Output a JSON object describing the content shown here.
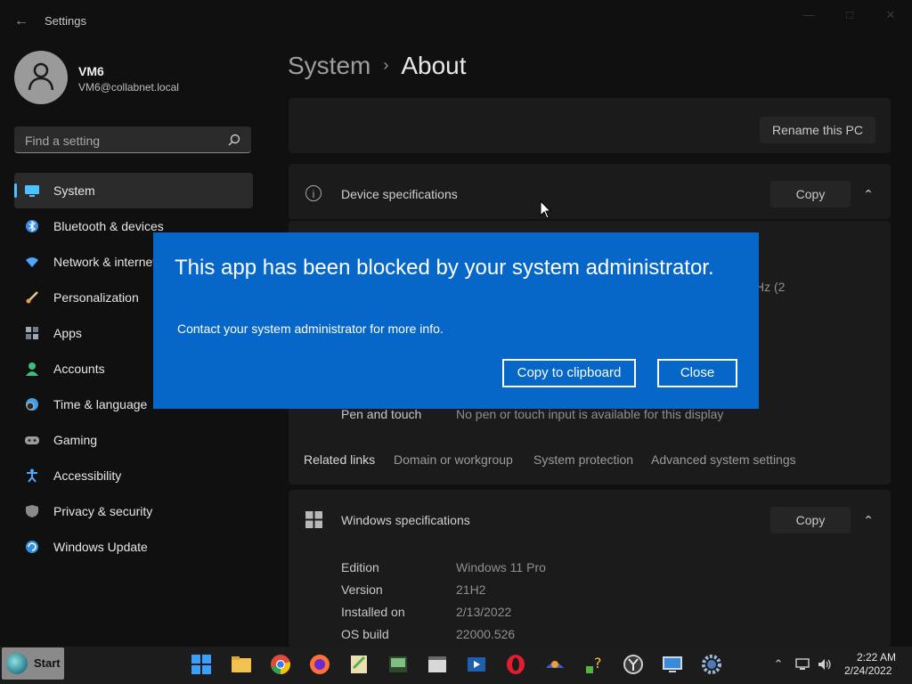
{
  "window": {
    "app_title": "Settings",
    "back_icon": "back-arrow-icon",
    "controls": {
      "minimize": "—",
      "maximize": "□",
      "close": "✕"
    }
  },
  "user": {
    "name": "VM6",
    "email": "VM6@collabnet.local",
    "avatar_icon": "person-icon"
  },
  "search": {
    "placeholder": "Find a setting"
  },
  "sidebar": {
    "items": [
      {
        "label": "System",
        "icon": "monitor-icon",
        "color": "#4cc2ff",
        "active": true
      },
      {
        "label": "Bluetooth & devices",
        "icon": "bluetooth-icon",
        "color": "#3b8ee8"
      },
      {
        "label": "Network & internet",
        "icon": "wifi-icon",
        "color": "#4ca8ff"
      },
      {
        "label": "Personalization",
        "icon": "brush-icon",
        "color": "#e8a050"
      },
      {
        "label": "Apps",
        "icon": "apps-icon",
        "color": "#9fa9b8"
      },
      {
        "label": "Accounts",
        "icon": "account-icon",
        "color": "#3fbf7f"
      },
      {
        "label": "Time & language",
        "icon": "clock-globe-icon",
        "color": "#3f9fe8"
      },
      {
        "label": "Gaming",
        "icon": "gamepad-icon",
        "color": "#9c9c9c"
      },
      {
        "label": "Accessibility",
        "icon": "accessibility-icon",
        "color": "#4ca8ff"
      },
      {
        "label": "Privacy & security",
        "icon": "shield-icon",
        "color": "#8a8a8a"
      },
      {
        "label": "Windows Update",
        "icon": "update-icon",
        "color": "#2f8fe0"
      }
    ]
  },
  "breadcrumb": {
    "parent": "System",
    "separator": "›",
    "current": "About"
  },
  "rename": {
    "label": "Rename this PC"
  },
  "device_specs": {
    "title": "Device specifications",
    "copy_label": "Copy",
    "partial_value": "Hz  (2",
    "rows": [
      {
        "label": "Pen and touch",
        "value": "No pen or touch input is available for this display"
      }
    ]
  },
  "related_links": {
    "title": "Related links",
    "links": [
      "Domain or workgroup",
      "System protection",
      "Advanced system settings"
    ]
  },
  "windows_specs": {
    "title": "Windows specifications",
    "copy_label": "Copy",
    "rows": [
      {
        "label": "Edition",
        "value": "Windows 11 Pro"
      },
      {
        "label": "Version",
        "value": "21H2"
      },
      {
        "label": "Installed on",
        "value": "2/13/2022"
      },
      {
        "label": "OS build",
        "value": "22000.526"
      }
    ]
  },
  "dialog": {
    "title": "This app has been blocked by your system administrator.",
    "message": "Contact your system administrator for more info.",
    "copy_button": "Copy to clipboard",
    "close_button": "Close",
    "background": "#0767c8"
  },
  "taskbar": {
    "start_label": "Start",
    "apps": [
      "windows-logo-icon",
      "file-explorer-icon",
      "chrome-icon",
      "firefox-icon",
      "notepad-plus-icon",
      "console-icon",
      "window-app-icon",
      "media-player-icon",
      "opera-icon",
      "app-icon",
      "help-icon",
      "clock-app-icon",
      "remote-desktop-icon",
      "settings-icon"
    ],
    "tray": [
      "chevron-up-icon",
      "network-icon",
      "volume-icon"
    ],
    "time": "2:22 AM",
    "date": "2/24/2022"
  }
}
